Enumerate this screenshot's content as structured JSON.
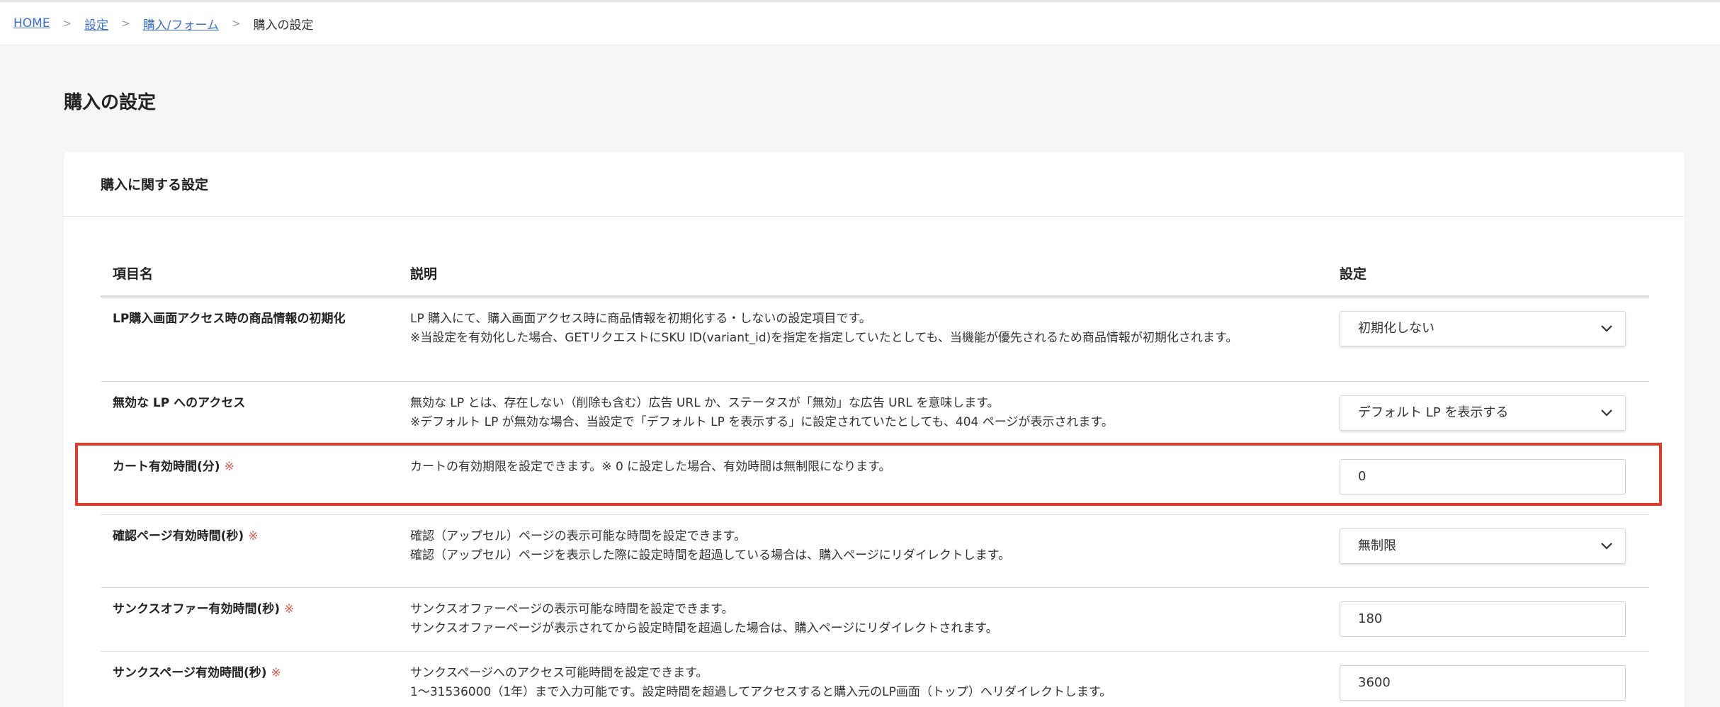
{
  "breadcrumb": {
    "items": [
      "HOME",
      "設定",
      "購入/フォーム"
    ],
    "separator": ">",
    "current": "購入の設定"
  },
  "page": {
    "title": "購入の設定"
  },
  "card": {
    "title": "購入に関する設定"
  },
  "table": {
    "headers": [
      "項目名",
      "説明",
      "設定"
    ],
    "required_mark": "※",
    "rows": [
      {
        "name": "LP購入画面アクセス時の商品情報の初期化",
        "desc": [
          "LP 購入にて、購入画面アクセス時に商品情報を初期化する・しないの設定項目です。",
          "※当設定を有効化した場合、GETリクエストにSKU ID(variant_id)を指定を指定していたとしても、当機能が優先されるため商品情報が初期化されます。"
        ],
        "control": "select",
        "value": "初期化しない"
      },
      {
        "name": "無効な LP へのアクセス",
        "desc": [
          "無効な LP とは、存在しない（削除も含む）広告 URL か、ステータスが「無効」な広告 URL を意味します。",
          "※デフォルト LP が無効な場合、当設定で「デフォルト LP を表示する」に設定されていたとしても、404 ページが表示されます。"
        ],
        "control": "select",
        "value": "デフォルト LP を表示する"
      },
      {
        "name": "カート有効時間(分)",
        "desc": [
          "カートの有効期限を設定できます。※ 0 に設定した場合、有効時間は無制限になります。"
        ],
        "control": "input",
        "value": "0"
      },
      {
        "name": "確認ページ有効時間(秒)",
        "desc": [
          "確認（アップセル）ページの表示可能な時間を設定できます。",
          "確認（アップセル）ページを表示した際に設定時間を超過している場合は、購入ページにリダイレクトします。"
        ],
        "control": "select",
        "value": "無制限"
      },
      {
        "name": "サンクスオファー有効時間(秒)",
        "desc": [
          "サンクスオファーページの表示可能な時間を設定できます。",
          "サンクスオファーページが表示されてから設定時間を超過した場合は、購入ページにリダイレクトされます。"
        ],
        "control": "input",
        "value": "180"
      },
      {
        "name": "サンクスページ有効時間(秒)",
        "desc": [
          "サンクスページへのアクセス可能時間を設定できます。",
          "1〜31536000（1年）まで入力可能です。設定時間を超過してアクセスすると購入元のLP画面（トップ）へリダイレクトします。"
        ],
        "control": "input",
        "value": "3600"
      }
    ]
  },
  "colors": {
    "link": "#3b6fd6",
    "required": "#e05a4a",
    "highlight": "#e23b27"
  }
}
